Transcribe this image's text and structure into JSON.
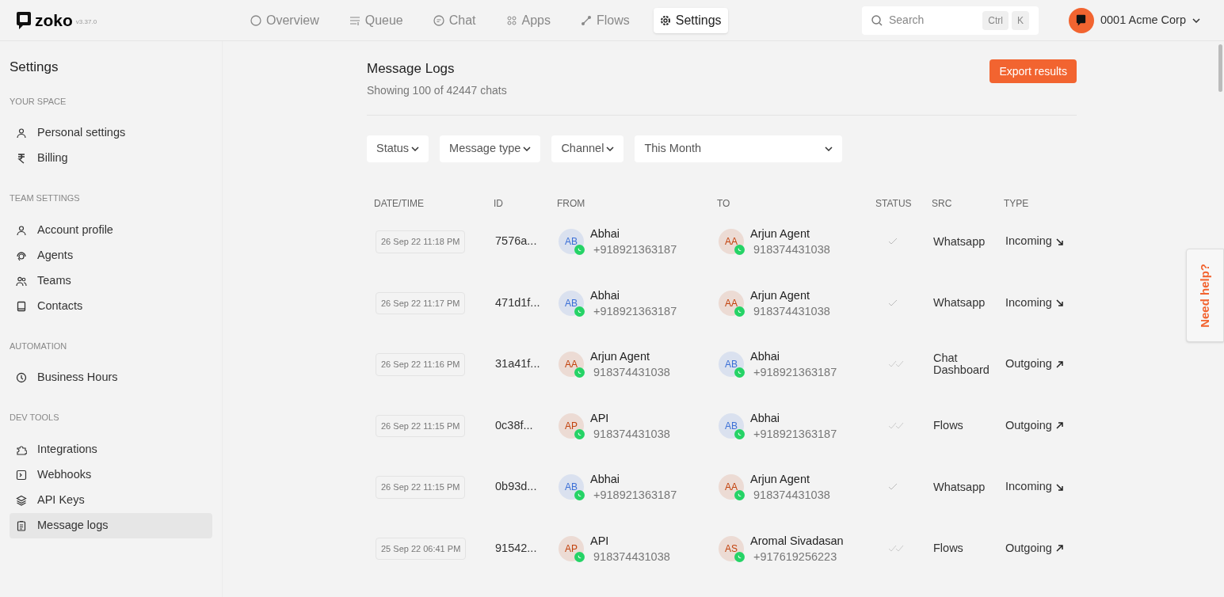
{
  "brand": {
    "name": "zoko",
    "version": "v3.37.0"
  },
  "nav": [
    {
      "label": "Overview",
      "selected": false
    },
    {
      "label": "Queue",
      "selected": false
    },
    {
      "label": "Chat",
      "selected": false
    },
    {
      "label": "Apps",
      "selected": false
    },
    {
      "label": "Flows",
      "selected": false
    },
    {
      "label": "Settings",
      "selected": true
    }
  ],
  "search": {
    "placeholder": "Search",
    "keys": [
      "Ctrl",
      "K"
    ]
  },
  "account": {
    "name": "0001 Acme Corp"
  },
  "sidebar": {
    "title": "Settings",
    "sections": [
      {
        "heading": "YOUR SPACE",
        "items": [
          {
            "label": "Personal settings",
            "selected": false
          },
          {
            "label": "Billing",
            "selected": false
          }
        ]
      },
      {
        "heading": "TEAM SETTINGS",
        "items": [
          {
            "label": "Account profile",
            "selected": false
          },
          {
            "label": "Agents",
            "selected": false
          },
          {
            "label": "Teams",
            "selected": false
          },
          {
            "label": "Contacts",
            "selected": false
          }
        ]
      },
      {
        "heading": "AUTOMATION",
        "items": [
          {
            "label": "Business Hours",
            "selected": false
          }
        ]
      },
      {
        "heading": "DEV TOOLS",
        "items": [
          {
            "label": "Integrations",
            "selected": false
          },
          {
            "label": "Webhooks",
            "selected": false
          },
          {
            "label": "API Keys",
            "selected": false
          },
          {
            "label": "Message logs",
            "selected": true
          }
        ]
      }
    ]
  },
  "page": {
    "title": "Message Logs",
    "subtitle": "Showing 100 of 42447 chats",
    "export_button": "Export results"
  },
  "filters": [
    {
      "label": "Status",
      "kind": "dropdown"
    },
    {
      "label": "Message type",
      "kind": "dropdown"
    },
    {
      "label": "Channel",
      "kind": "dropdown"
    },
    {
      "label": "This Month",
      "kind": "range"
    }
  ],
  "table": {
    "columns": [
      "DATE/TIME",
      "ID",
      "FROM",
      "TO",
      "STATUS",
      "SRC",
      "TYPE"
    ],
    "rows": [
      {
        "datetime": "26 Sep 22 11:18 PM",
        "id": "7576a...",
        "from": {
          "initials": "AB",
          "name": "Abhai",
          "phone": "+918921363187",
          "color": "#3b6fd6"
        },
        "to": {
          "initials": "AA",
          "name": "Arjun Agent",
          "phone": "918374431038",
          "color": "#c2410c"
        },
        "delivered": false,
        "src": "Whatsapp",
        "type": "Incoming",
        "incoming": true
      },
      {
        "datetime": "26 Sep 22 11:17 PM",
        "id": "471d1f...",
        "from": {
          "initials": "AB",
          "name": "Abhai",
          "phone": "+918921363187",
          "color": "#3b6fd6"
        },
        "to": {
          "initials": "AA",
          "name": "Arjun Agent",
          "phone": "918374431038",
          "color": "#c2410c"
        },
        "delivered": false,
        "src": "Whatsapp",
        "type": "Incoming",
        "incoming": true
      },
      {
        "datetime": "26 Sep 22 11:16 PM",
        "id": "31a41f...",
        "from": {
          "initials": "AA",
          "name": "Arjun Agent",
          "phone": "918374431038",
          "color": "#c2410c"
        },
        "to": {
          "initials": "AB",
          "name": "Abhai",
          "phone": "+918921363187",
          "color": "#3b6fd6"
        },
        "delivered": true,
        "src": "Chat Dashboard",
        "type": "Outgoing",
        "incoming": false
      },
      {
        "datetime": "26 Sep 22 11:15 PM",
        "id": "0c38f...",
        "from": {
          "initials": "AP",
          "name": "API",
          "phone": "918374431038",
          "color": "#c2410c"
        },
        "to": {
          "initials": "AB",
          "name": "Abhai",
          "phone": "+918921363187",
          "color": "#3b6fd6"
        },
        "delivered": true,
        "src": "Flows",
        "type": "Outgoing",
        "incoming": false
      },
      {
        "datetime": "26 Sep 22 11:15 PM",
        "id": "0b93d...",
        "from": {
          "initials": "AB",
          "name": "Abhai",
          "phone": "+918921363187",
          "color": "#3b6fd6"
        },
        "to": {
          "initials": "AA",
          "name": "Arjun Agent",
          "phone": "918374431038",
          "color": "#c2410c"
        },
        "delivered": false,
        "src": "Whatsapp",
        "type": "Incoming",
        "incoming": true
      },
      {
        "datetime": "25 Sep 22 06:41 PM",
        "id": "91542...",
        "from": {
          "initials": "AP",
          "name": "API",
          "phone": "918374431038",
          "color": "#c2410c"
        },
        "to": {
          "initials": "AS",
          "name": "Aromal Sivadasan",
          "phone": "+917619256223",
          "color": "#c2410c"
        },
        "delivered": true,
        "src": "Flows",
        "type": "Outgoing",
        "incoming": false
      }
    ]
  },
  "help_tab": "Need help?"
}
